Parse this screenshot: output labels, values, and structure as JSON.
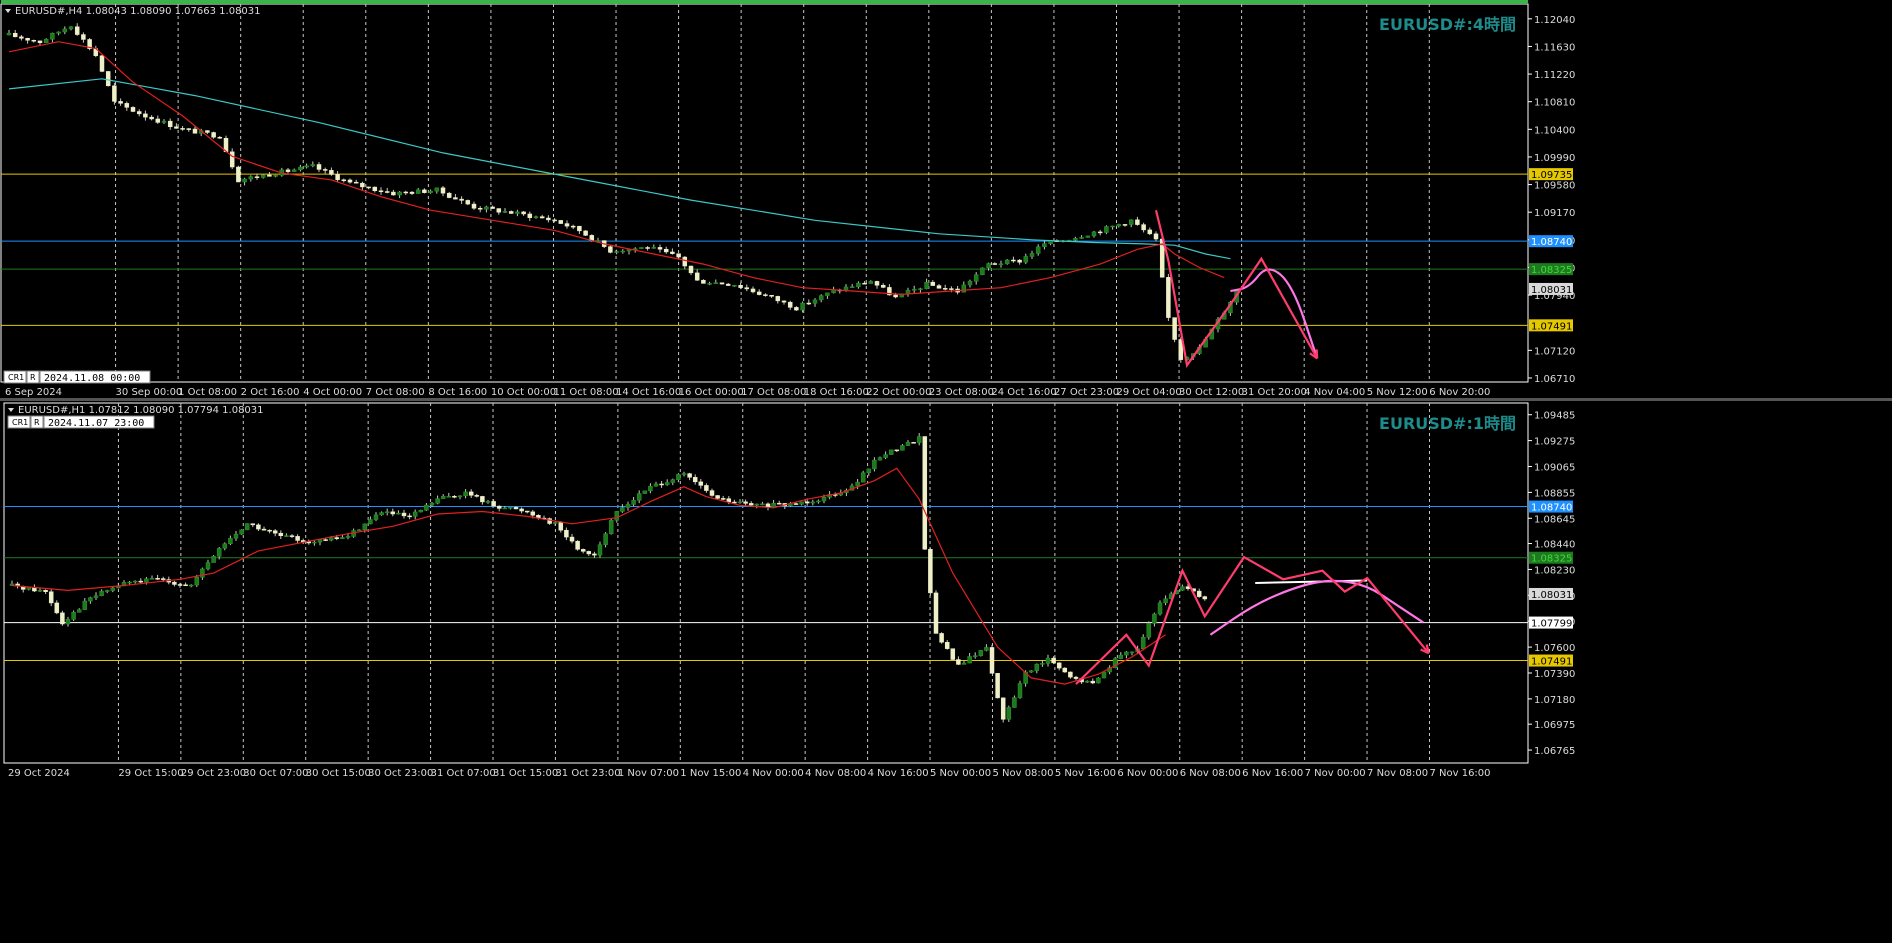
{
  "chart_data": [
    {
      "type": "candlestick",
      "symbol_line": "EURUSD#,H4  1.08043 1.08090 1.07663 1.08031",
      "watermark": "EURUSD#:4時間",
      "time_box": {
        "prefix": "CR1",
        "mode": "R",
        "value": "2024.11.08 00:00"
      },
      "ylim": [
        1.0665,
        1.1226
      ],
      "y_ticks": [
        "1.12040",
        "1.11630",
        "1.11220",
        "1.10810",
        "1.10400",
        "1.09990",
        "1.09580",
        "1.09170",
        "1.08760",
        "1.08350",
        "1.07940",
        "1.07120",
        "1.06710"
      ],
      "x_ticks": [
        "6 Sep 2024",
        "30 Sep 00:00",
        "1 Oct 08:00",
        "2 Oct 16:00",
        "4 Oct 00:00",
        "7 Oct 08:00",
        "8 Oct 16:00",
        "10 Oct 00:00",
        "11 Oct 08:00",
        "14 Oct 16:00",
        "16 Oct 00:00",
        "17 Oct 08:00",
        "18 Oct 16:00",
        "22 Oct 00:00",
        "23 Oct 08:00",
        "24 Oct 16:00",
        "27 Oct 23:00",
        "29 Oct 04:00",
        "30 Oct 12:00",
        "31 Oct 20:00",
        "4 Nov 04:00",
        "5 Nov 12:00",
        "6 Nov 20:00"
      ],
      "levels": [
        {
          "value": 1.09735,
          "label": "1.09735",
          "color": "#e6c800",
          "label_bg": "#e6c800",
          "label_fg": "#000000"
        },
        {
          "value": 1.0874,
          "label": "1.08740",
          "color": "#1e90ff",
          "label_bg": "#1e90ff",
          "label_fg": "#ffffff"
        },
        {
          "value": 1.08325,
          "label": "1.08325",
          "color": "#1f7a1f",
          "label_bg": "#1f7a1f",
          "label_fg": "#3cdc3c"
        },
        {
          "value": 1.08031,
          "label": "1.08031",
          "color": "#808080",
          "label_bg": "#d9d9d9",
          "label_fg": "#000000",
          "no_line": true
        },
        {
          "value": 1.07491,
          "label": "1.07491",
          "color": "#e6c800",
          "label_bg": "#e6c800",
          "label_fg": "#000000"
        }
      ],
      "ma_fast_color": "#e02020",
      "ma_slow_color": "#3cc8c8",
      "ma_fast": [
        [
          0,
          1.1155
        ],
        [
          8,
          1.117
        ],
        [
          14,
          1.116
        ],
        [
          20,
          1.111
        ],
        [
          28,
          1.106
        ],
        [
          36,
          1.1
        ],
        [
          44,
          1.0975
        ],
        [
          52,
          1.0965
        ],
        [
          60,
          1.094
        ],
        [
          68,
          1.092
        ],
        [
          78,
          1.0905
        ],
        [
          88,
          1.089
        ],
        [
          96,
          1.087
        ],
        [
          104,
          1.0855
        ],
        [
          112,
          1.084
        ],
        [
          120,
          1.082
        ],
        [
          128,
          1.0805
        ],
        [
          136,
          1.08
        ],
        [
          144,
          1.0795
        ],
        [
          152,
          1.08
        ],
        [
          160,
          1.0805
        ],
        [
          168,
          1.082
        ],
        [
          176,
          1.084
        ],
        [
          182,
          1.0862
        ],
        [
          186,
          1.087
        ],
        [
          188,
          1.0855
        ],
        [
          192,
          1.0835
        ],
        [
          196,
          1.082
        ]
      ],
      "ma_slow": [
        [
          0,
          1.11
        ],
        [
          15,
          1.1115
        ],
        [
          30,
          1.109
        ],
        [
          50,
          1.105
        ],
        [
          70,
          1.1005
        ],
        [
          90,
          1.097
        ],
        [
          110,
          1.0935
        ],
        [
          130,
          1.0905
        ],
        [
          150,
          1.0885
        ],
        [
          165,
          1.0876
        ],
        [
          175,
          1.0872
        ],
        [
          183,
          1.087
        ],
        [
          188,
          1.0868
        ],
        [
          193,
          1.0855
        ],
        [
          197,
          1.0848
        ]
      ],
      "candles_anchor": [
        [
          0,
          1.118
        ],
        [
          5,
          1.117
        ],
        [
          10,
          1.1195
        ],
        [
          14,
          1.115
        ],
        [
          17,
          1.108
        ],
        [
          22,
          1.106
        ],
        [
          28,
          1.104
        ],
        [
          34,
          1.103
        ],
        [
          37,
          1.0965
        ],
        [
          43,
          1.0975
        ],
        [
          49,
          1.0985
        ],
        [
          55,
          1.096
        ],
        [
          62,
          1.0945
        ],
        [
          69,
          1.095
        ],
        [
          75,
          1.0925
        ],
        [
          82,
          1.0915
        ],
        [
          88,
          1.0905
        ],
        [
          92,
          1.089
        ],
        [
          97,
          1.086
        ],
        [
          103,
          1.0865
        ],
        [
          108,
          1.085
        ],
        [
          111,
          1.0815
        ],
        [
          117,
          1.081
        ],
        [
          123,
          1.079
        ],
        [
          127,
          1.0775
        ],
        [
          133,
          1.08
        ],
        [
          139,
          1.0815
        ],
        [
          143,
          1.079
        ],
        [
          148,
          1.081
        ],
        [
          153,
          1.08
        ],
        [
          158,
          1.084
        ],
        [
          163,
          1.0845
        ],
        [
          167,
          1.087
        ],
        [
          172,
          1.088
        ],
        [
          176,
          1.089
        ],
        [
          181,
          1.0905
        ],
        [
          185,
          1.0875
        ],
        [
          187,
          1.076
        ],
        [
          189,
          1.07
        ],
        [
          192,
          1.0715
        ],
        [
          196,
          1.077
        ],
        [
          198,
          1.08
        ]
      ],
      "forecast": {
        "pink_zigzag": [
          [
            185,
            1.092
          ],
          [
            187,
            1.0845
          ],
          [
            190,
            1.069
          ],
          [
            197,
            1.078
          ],
          [
            202,
            1.0848
          ],
          [
            211,
            1.07
          ]
        ],
        "magenta_curve": [
          [
            197,
            1.08
          ],
          [
            200,
            1.0805
          ],
          [
            203,
            1.084
          ],
          [
            207,
            1.081
          ],
          [
            211,
            1.07
          ]
        ]
      }
    },
    {
      "type": "candlestick",
      "symbol_line": "EURUSD#,H1  1.07812 1.08090 1.07794 1.08031",
      "watermark": "EURUSD#:1時間",
      "time_box": {
        "prefix": "CR1",
        "mode": "R",
        "value": "2024.11.07 23:00"
      },
      "ylim": [
        1.0666,
        1.0958
      ],
      "y_ticks": [
        "1.09485",
        "1.09275",
        "1.09065",
        "1.08855",
        "1.08645",
        "1.08440",
        "1.08230",
        "1.08020",
        "1.07810",
        "1.07600",
        "1.07390",
        "1.07180",
        "1.06975",
        "1.06765"
      ],
      "x_ticks": [
        "29 Oct 2024",
        "29 Oct 15:00",
        "29 Oct 23:00",
        "30 Oct 07:00",
        "30 Oct 15:00",
        "30 Oct 23:00",
        "31 Oct 07:00",
        "31 Oct 15:00",
        "31 Oct 23:00",
        "1 Nov 07:00",
        "1 Nov 15:00",
        "4 Nov 00:00",
        "4 Nov 08:00",
        "4 Nov 16:00",
        "5 Nov 00:00",
        "5 Nov 08:00",
        "5 Nov 16:00",
        "6 Nov 00:00",
        "6 Nov 08:00",
        "6 Nov 16:00",
        "7 Nov 00:00",
        "7 Nov 08:00",
        "7 Nov 16:00"
      ],
      "levels": [
        {
          "value": 1.0874,
          "label": "1.08740",
          "color": "#1e90ff",
          "label_bg": "#1e90ff",
          "label_fg": "#ffffff"
        },
        {
          "value": 1.08325,
          "label": "1.08325",
          "color": "#1f7a1f",
          "label_bg": "#1f7a1f",
          "label_fg": "#3cdc3c"
        },
        {
          "value": 1.08031,
          "label": "1.08031",
          "color": "#808080",
          "label_bg": "#d9d9d9",
          "label_fg": "#000000",
          "no_line": true
        },
        {
          "value": 1.07799,
          "label": "1.07799",
          "color": "#ffffff",
          "label_bg": "#ffffff",
          "label_fg": "#000000"
        },
        {
          "value": 1.07491,
          "label": "1.07491",
          "color": "#e6c800",
          "label_bg": "#e6c800",
          "label_fg": "#000000"
        }
      ],
      "ma_fast_color": "#e02020",
      "ma_fast": [
        [
          0,
          1.081
        ],
        [
          10,
          1.0806
        ],
        [
          20,
          1.081
        ],
        [
          30,
          1.0815
        ],
        [
          36,
          1.082
        ],
        [
          44,
          1.0838
        ],
        [
          52,
          1.0845
        ],
        [
          60,
          1.0852
        ],
        [
          68,
          1.0858
        ],
        [
          76,
          1.0868
        ],
        [
          84,
          1.087
        ],
        [
          92,
          1.0866
        ],
        [
          100,
          1.086
        ],
        [
          108,
          1.0865
        ],
        [
          114,
          1.0878
        ],
        [
          120,
          1.089
        ],
        [
          124,
          1.0882
        ],
        [
          130,
          1.0875
        ],
        [
          136,
          1.0873
        ],
        [
          142,
          1.088
        ],
        [
          148,
          1.0885
        ],
        [
          154,
          1.0895
        ],
        [
          158,
          1.0905
        ],
        [
          162,
          1.088
        ],
        [
          168,
          1.082
        ],
        [
          176,
          1.076
        ],
        [
          182,
          1.0735
        ],
        [
          188,
          1.073
        ],
        [
          194,
          1.0738
        ],
        [
          200,
          1.0752
        ],
        [
          206,
          1.077
        ]
      ],
      "candles_anchor": [
        [
          0,
          1.081
        ],
        [
          6,
          1.0805
        ],
        [
          9,
          1.078
        ],
        [
          14,
          1.08
        ],
        [
          20,
          1.0812
        ],
        [
          26,
          1.0815
        ],
        [
          32,
          1.081
        ],
        [
          37,
          1.084
        ],
        [
          42,
          1.086
        ],
        [
          48,
          1.085
        ],
        [
          54,
          1.0845
        ],
        [
          60,
          1.085
        ],
        [
          66,
          1.087
        ],
        [
          71,
          1.0865
        ],
        [
          76,
          1.088
        ],
        [
          81,
          1.0885
        ],
        [
          86,
          1.0875
        ],
        [
          92,
          1.087
        ],
        [
          97,
          1.086
        ],
        [
          101,
          1.084
        ],
        [
          104,
          1.0835
        ],
        [
          108,
          1.087
        ],
        [
          114,
          1.089
        ],
        [
          120,
          1.09
        ],
        [
          126,
          1.088
        ],
        [
          132,
          1.0875
        ],
        [
          138,
          1.0875
        ],
        [
          144,
          1.088
        ],
        [
          150,
          1.089
        ],
        [
          155,
          1.0915
        ],
        [
          160,
          1.0925
        ],
        [
          162,
          1.093
        ],
        [
          163,
          1.084
        ],
        [
          165,
          1.077
        ],
        [
          169,
          1.0745
        ],
        [
          174,
          1.076
        ],
        [
          177,
          1.07
        ],
        [
          181,
          1.074
        ],
        [
          185,
          1.075
        ],
        [
          189,
          1.0735
        ],
        [
          193,
          1.073
        ],
        [
          197,
          1.075
        ],
        [
          201,
          1.076
        ],
        [
          205,
          1.0795
        ],
        [
          209,
          1.081
        ],
        [
          213,
          1.08
        ]
      ],
      "forecast": {
        "pink_zigzag": [
          [
            190,
            1.073
          ],
          [
            199,
            1.077
          ],
          [
            203,
            1.0745
          ],
          [
            209,
            1.0822
          ],
          [
            213,
            1.0785
          ],
          [
            220,
            1.0833
          ],
          [
            227,
            1.0815
          ],
          [
            234,
            1.0822
          ],
          [
            238,
            1.0805
          ],
          [
            242,
            1.0816
          ],
          [
            253,
            1.0755
          ]
        ],
        "magenta_curve": [
          [
            214,
            1.077
          ],
          [
            222,
            1.0795
          ],
          [
            230,
            1.081
          ],
          [
            236,
            1.0815
          ],
          [
            242,
            1.081
          ],
          [
            247,
            1.0795
          ],
          [
            252,
            1.078
          ]
        ],
        "white_line": [
          [
            222,
            1.0812
          ],
          [
            242,
            1.0814
          ]
        ]
      }
    }
  ]
}
